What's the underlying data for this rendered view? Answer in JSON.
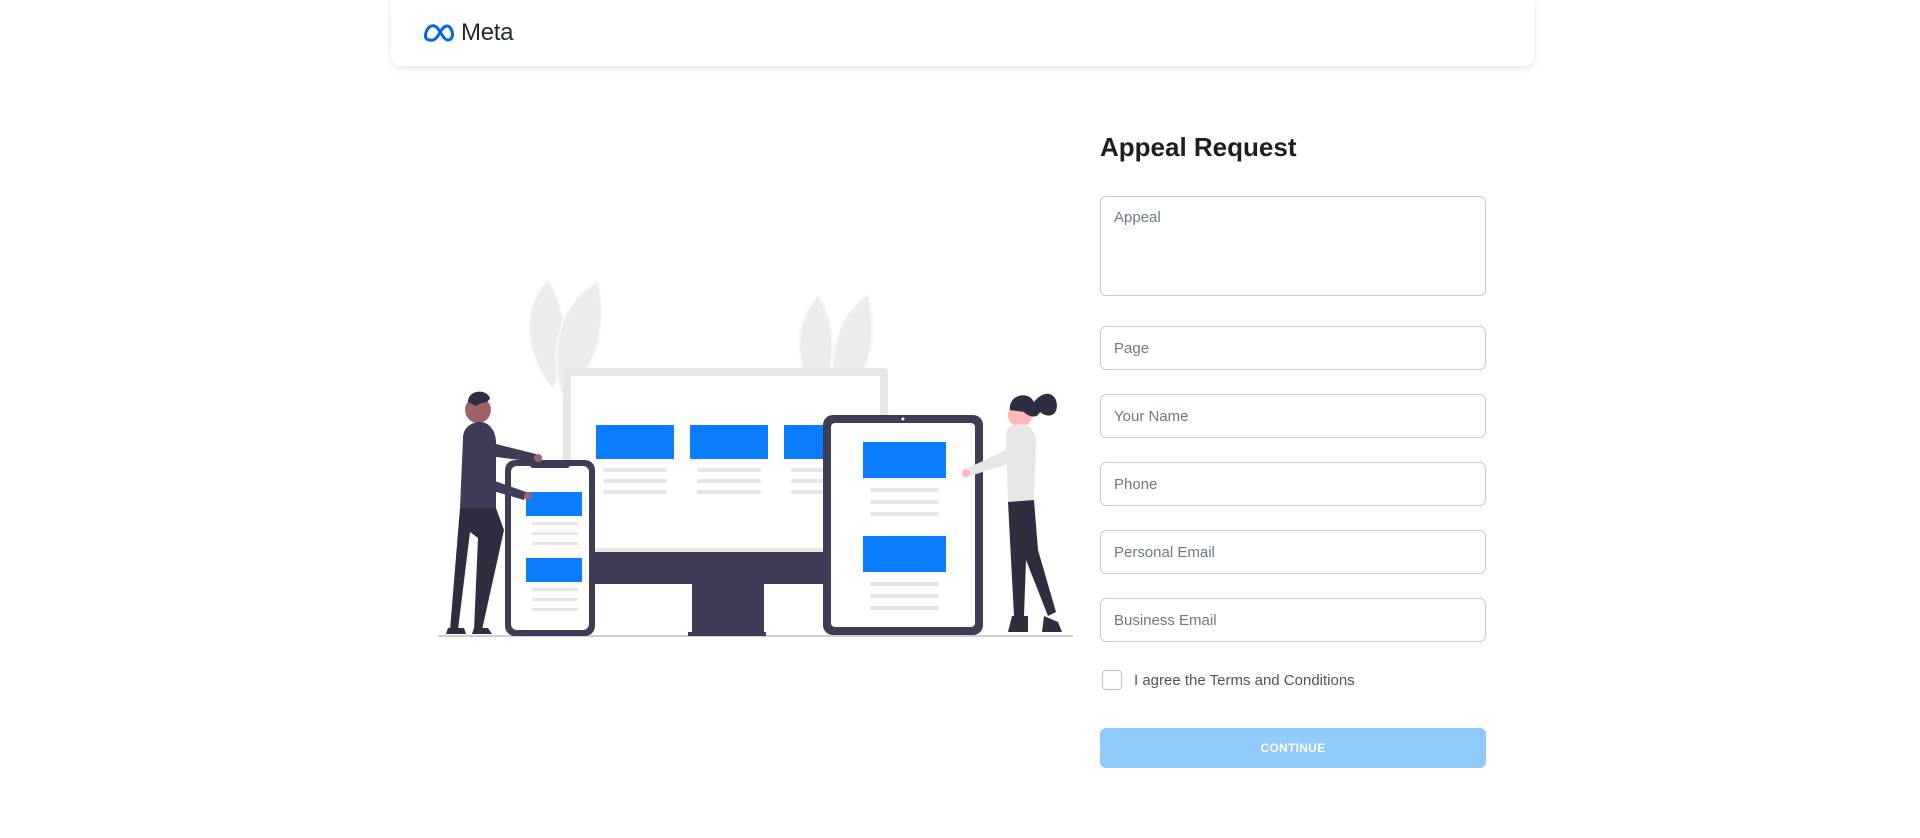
{
  "header": {
    "brand": "Meta",
    "logo_icon": "meta-infinity-icon"
  },
  "form": {
    "title": "Appeal Request",
    "fields": {
      "appeal": {
        "placeholder": "Appeal",
        "value": ""
      },
      "page": {
        "placeholder": "Page",
        "value": ""
      },
      "name": {
        "placeholder": "Your Name",
        "value": ""
      },
      "phone": {
        "placeholder": "Phone",
        "value": ""
      },
      "personal_email": {
        "placeholder": "Personal Email",
        "value": ""
      },
      "business_email": {
        "placeholder": "Business Email",
        "value": ""
      }
    },
    "terms_label": "I agree the Terms and Conditions",
    "terms_checked": false,
    "continue_label": "CONTINUE"
  },
  "colors": {
    "accent": "#0a7cff",
    "button_disabled": "#90caf9",
    "meta_blue": "#0668e1",
    "illustration_dark": "#3f3d56"
  }
}
